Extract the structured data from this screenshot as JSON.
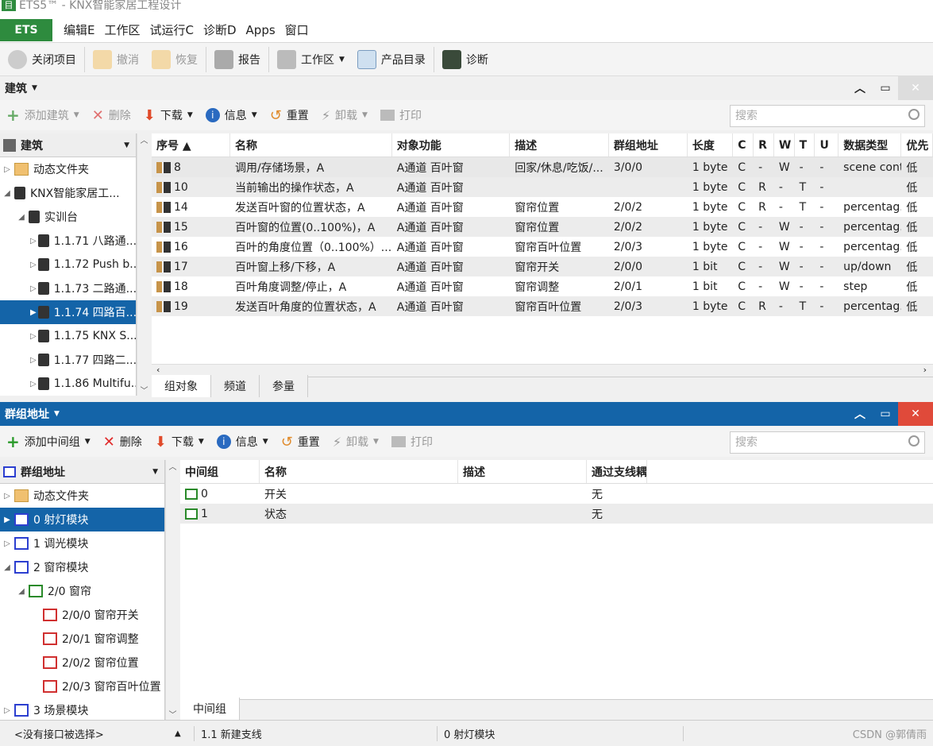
{
  "window": {
    "title": "ETS5™ - KNX智能家居工程设计"
  },
  "menu": {
    "ets": "ETS",
    "items": [
      "编辑E",
      "工作区",
      "试运行C",
      "诊断D",
      "Apps",
      "窗口"
    ]
  },
  "toolbar": {
    "close_project": "关闭项目",
    "undo": "撤消",
    "redo": "恢复",
    "report": "报告",
    "workspace": "工作区",
    "catalog": "产品目录",
    "diagnostics": "诊断"
  },
  "building": {
    "header": "建筑",
    "toolbar": {
      "add": "添加建筑",
      "delete": "删除",
      "download": "下载",
      "info": "信息",
      "reset": "重置",
      "unload": "卸载",
      "print": "打印"
    },
    "search_placeholder": "搜索",
    "tree_header": "建筑",
    "tree": [
      {
        "label": "动态文件夹",
        "arrow": "▷",
        "icon": "folder",
        "indent": 0
      },
      {
        "label": "KNX智能家居工...",
        "arrow": "◢",
        "icon": "building",
        "indent": 0
      },
      {
        "label": "实训台",
        "arrow": "◢",
        "icon": "room",
        "indent": 1
      },
      {
        "label": "1.1.71 八路通...",
        "arrow": "▷",
        "icon": "device",
        "indent": 2
      },
      {
        "label": "1.1.72 Push b...",
        "arrow": "▷",
        "icon": "device",
        "indent": 2
      },
      {
        "label": "1.1.73 二路通...",
        "arrow": "▷",
        "icon": "device",
        "indent": 2
      },
      {
        "label": "1.1.74 四路百...",
        "arrow": "▶",
        "icon": "device",
        "indent": 2,
        "selected": true
      },
      {
        "label": "1.1.75 KNX S...",
        "arrow": "▷",
        "icon": "device",
        "indent": 2
      },
      {
        "label": "1.1.77 四路二...",
        "arrow": "▷",
        "icon": "device",
        "indent": 2
      },
      {
        "label": "1.1.86 Multifu...",
        "arrow": "▷",
        "icon": "device",
        "indent": 2
      }
    ],
    "columns": [
      "序号 ▲",
      "名称",
      "对象功能",
      "描述",
      "群组地址",
      "长度",
      "C",
      "R",
      "W",
      "T",
      "U",
      "数据类型",
      "优先"
    ],
    "rows": [
      [
        "8",
        "调用/存储场景，A",
        "A通道 百叶窗",
        "回家/休息/吃饭/...",
        "3/0/0",
        "1 byte",
        "C",
        "-",
        "W",
        "-",
        "-",
        "scene cont...",
        "低"
      ],
      [
        "10",
        "当前输出的操作状态，A",
        "A通道 百叶窗",
        "",
        "",
        "1 byte",
        "C",
        "R",
        "-",
        "T",
        "-",
        "",
        "低"
      ],
      [
        "14",
        "发送百叶窗的位置状态，A",
        "A通道 百叶窗",
        "窗帘位置",
        "2/0/2",
        "1 byte",
        "C",
        "R",
        "-",
        "T",
        "-",
        "percentag...",
        "低"
      ],
      [
        "15",
        "百叶窗的位置(0..100%)，A",
        "A通道 百叶窗",
        "窗帘位置",
        "2/0/2",
        "1 byte",
        "C",
        "-",
        "W",
        "-",
        "-",
        "percentag...",
        "低"
      ],
      [
        "16",
        "百叶的角度位置（0..100%）...",
        "A通道 百叶窗",
        "窗帘百叶位置",
        "2/0/3",
        "1 byte",
        "C",
        "-",
        "W",
        "-",
        "-",
        "percentag...",
        "低"
      ],
      [
        "17",
        "百叶窗上移/下移，A",
        "A通道 百叶窗",
        "窗帘开关",
        "2/0/0",
        "1 bit",
        "C",
        "-",
        "W",
        "-",
        "-",
        "up/down",
        "低"
      ],
      [
        "18",
        "百叶角度调整/停止，A",
        "A通道 百叶窗",
        "窗帘调整",
        "2/0/1",
        "1 bit",
        "C",
        "-",
        "W",
        "-",
        "-",
        "step",
        "低"
      ],
      [
        "19",
        "发送百叶角度的位置状态，A",
        "A通道 百叶窗",
        "窗帘百叶位置",
        "2/0/3",
        "1 byte",
        "C",
        "R",
        "-",
        "T",
        "-",
        "percentag...",
        "低"
      ]
    ],
    "tabs": [
      "组对象",
      "频道",
      "参量"
    ]
  },
  "groups": {
    "header": "群组地址",
    "toolbar": {
      "add": "添加中间组",
      "delete": "删除",
      "download": "下载",
      "info": "信息",
      "reset": "重置",
      "unload": "卸载",
      "print": "打印"
    },
    "search_placeholder": "搜索",
    "tree_header": "群组地址",
    "tree": [
      {
        "label": "动态文件夹",
        "arrow": "▷",
        "icon": "folder",
        "indent": 0
      },
      {
        "label": "0 射灯模块",
        "arrow": "▶",
        "icon": "grp",
        "indent": 0,
        "selected": true
      },
      {
        "label": "1 调光模块",
        "arrow": "▷",
        "icon": "grp",
        "indent": 0
      },
      {
        "label": "2 窗帘模块",
        "arrow": "◢",
        "icon": "grp",
        "indent": 0
      },
      {
        "label": "2/0 窗帘",
        "arrow": "◢",
        "icon": "grpg",
        "indent": 1
      },
      {
        "label": "2/0/0 窗帘开关",
        "arrow": "",
        "icon": "grpr",
        "indent": 2
      },
      {
        "label": "2/0/1 窗帘调整",
        "arrow": "",
        "icon": "grpr",
        "indent": 2
      },
      {
        "label": "2/0/2 窗帘位置",
        "arrow": "",
        "icon": "grpr",
        "indent": 2
      },
      {
        "label": "2/0/3 窗帘百叶位置",
        "arrow": "",
        "icon": "grpr",
        "indent": 2
      },
      {
        "label": "3 场景模块",
        "arrow": "▷",
        "icon": "grp",
        "indent": 0
      }
    ],
    "columns": [
      "中间组",
      "名称",
      "描述",
      "通过支线耦"
    ],
    "rows": [
      [
        "0",
        "开关",
        "",
        "无"
      ],
      [
        "1",
        "状态",
        "",
        "无"
      ]
    ],
    "tabs": [
      "中间组"
    ]
  },
  "status": {
    "interface": "<没有接口被选择>",
    "line": "1.1 新建支线",
    "group": "0 射灯模块",
    "watermark": "CSDN @郭倩雨"
  }
}
